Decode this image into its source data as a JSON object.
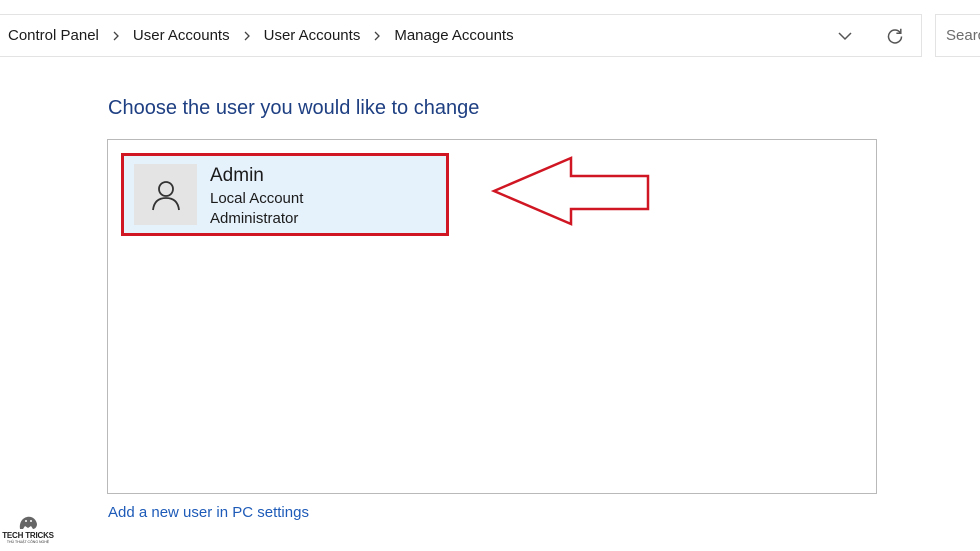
{
  "breadcrumb": {
    "items": [
      "Control Panel",
      "User Accounts",
      "User Accounts",
      "Manage Accounts"
    ]
  },
  "search": {
    "placeholder": "Search"
  },
  "heading": "Choose the user you would like to change",
  "account": {
    "name": "Admin",
    "type": "Local Account",
    "role": "Administrator"
  },
  "add_user_link": "Add a new user in PC settings",
  "watermark": {
    "title": "TECH TRICKS",
    "subtitle": "THỦ THUẬT CÔNG NGHỆ"
  },
  "colors": {
    "heading": "#1e3f82",
    "link": "#1e5bb8",
    "highlight": "#d01622",
    "tile_bg": "#e5f1fb"
  },
  "icons": [
    "chevron-right-icon",
    "chevron-down-icon",
    "refresh-icon",
    "user-icon",
    "arrow-left-icon"
  ]
}
